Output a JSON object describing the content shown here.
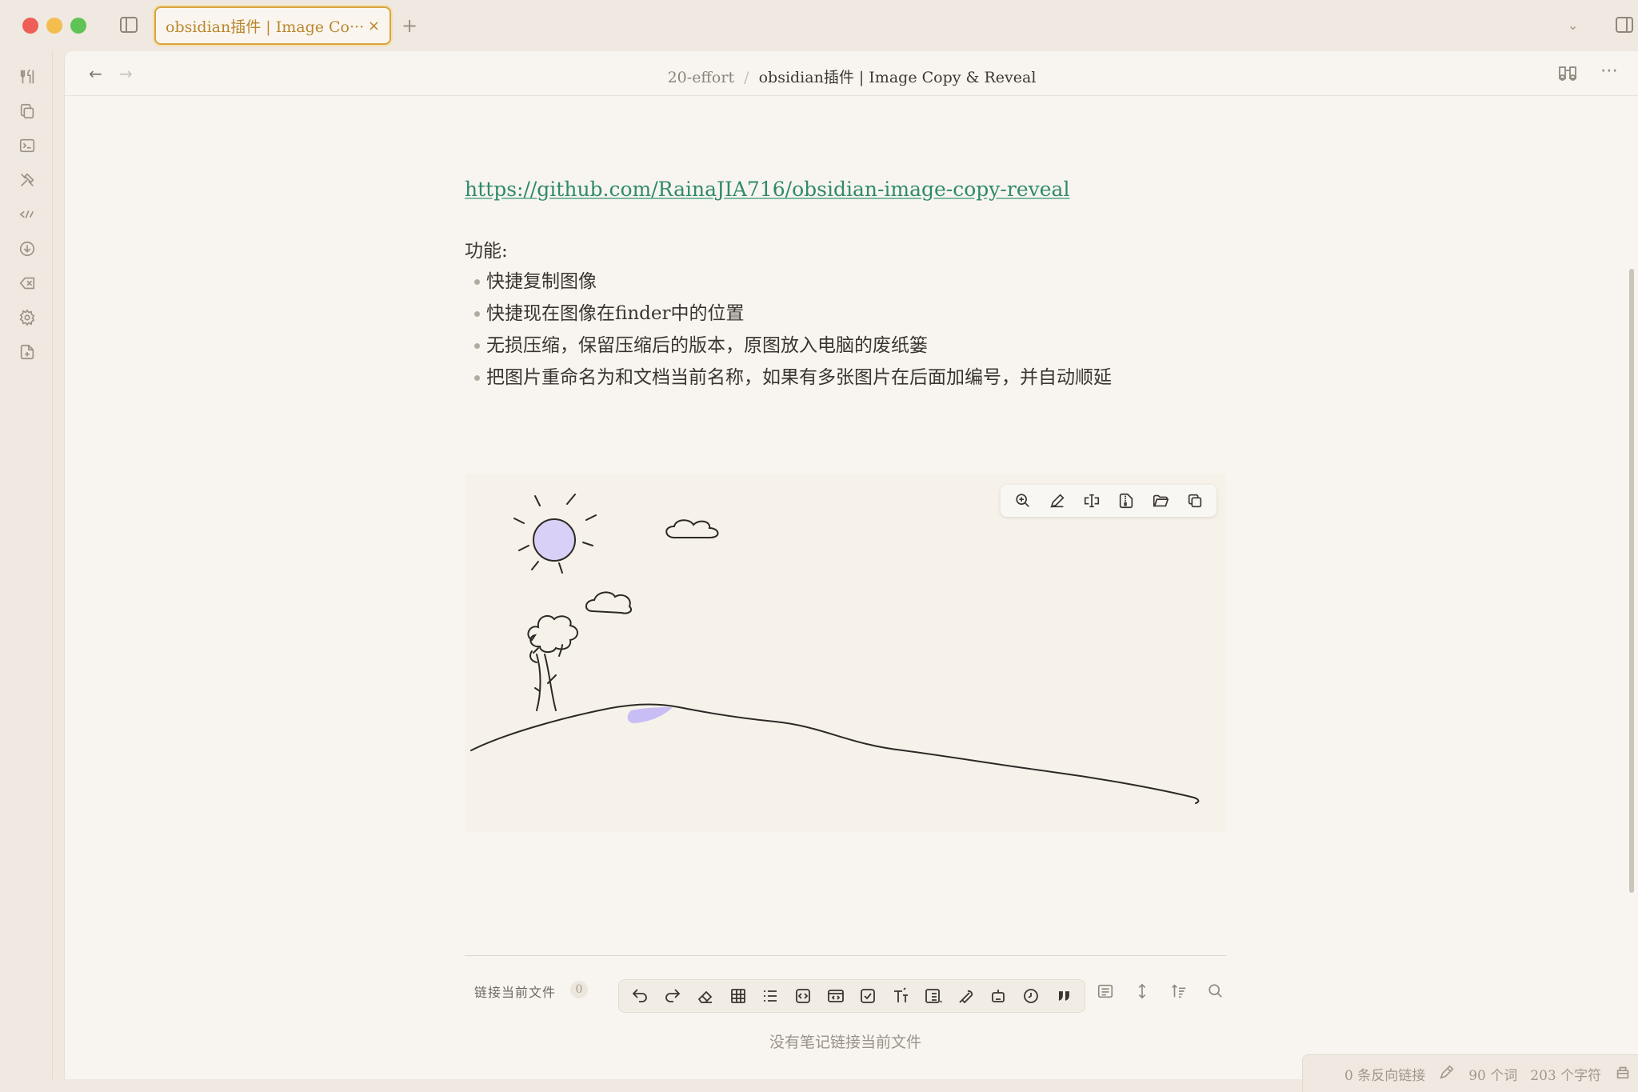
{
  "window": {
    "tab_title": "obsidian插件 | Image Co···",
    "tab_close": "×",
    "new_tab": "+",
    "tab_list": "⌄"
  },
  "header": {
    "back": "←",
    "forward": "→",
    "folder": "20-effort",
    "separator": "/",
    "note_title": "obsidian插件 | Image Copy & Reveal",
    "more": "⋯"
  },
  "note": {
    "link": "https://github.com/RainaJIA716/obsidian-image-copy-reveal",
    "features_heading": "功能:",
    "features": [
      "快捷复制图像",
      "快捷现在图像在finder中的位置",
      "无损压缩，保留压缩后的版本，原图放入电脑的废纸篓",
      "把图片重命名为和文档当前名称，如果有多张图片在后面加编号，并自动顺延"
    ]
  },
  "image_toolbar": {
    "icons": [
      "zoom-in-icon",
      "edit-icon",
      "rename-icon",
      "compress-file-icon",
      "reveal-folder-icon",
      "copy-icon"
    ]
  },
  "backlinks": {
    "label": "链接当前文件",
    "count": "0",
    "empty_message": "没有笔记链接当前文件"
  },
  "status_bar": {
    "backlinks": "0 条反向链接",
    "words": "90 个词",
    "chars": "203 个字符"
  },
  "colors": {
    "accent": "#d9a441",
    "link": "#2f8a6b",
    "sun_fill": "#d9d0f7",
    "background": "#f8f5f0"
  }
}
